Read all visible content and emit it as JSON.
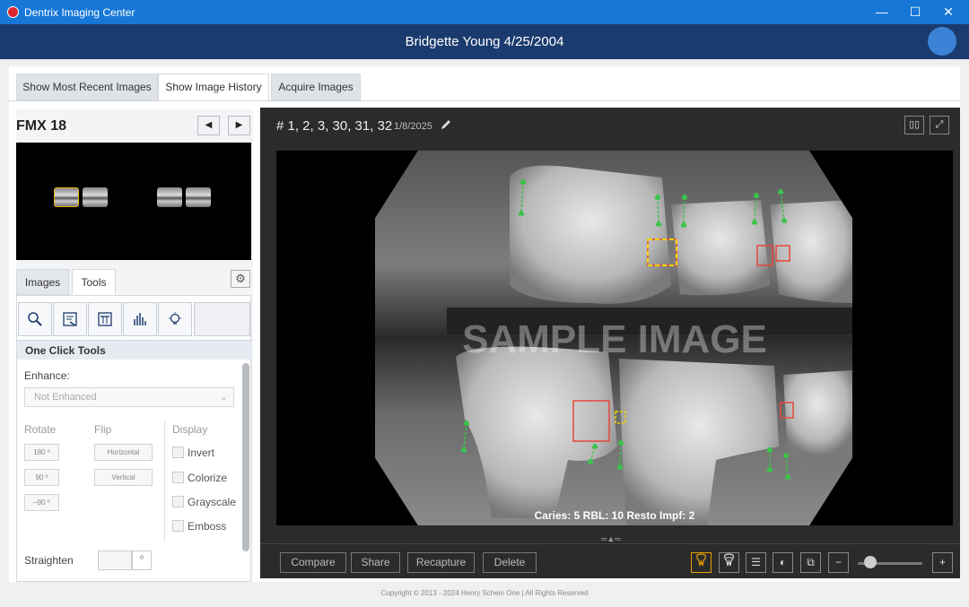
{
  "window": {
    "title": "Dentrix Imaging Center",
    "minimize": "—",
    "maximize": "☐",
    "close": "✕"
  },
  "header": {
    "patient": "Bridgette Young 4/25/2004"
  },
  "tabs": [
    "Show Most Recent Images",
    "Show Image History",
    "Acquire Images"
  ],
  "left": {
    "series_title": "FMX 18",
    "prev": "◀",
    "next": "▶",
    "subtabs": [
      "Images",
      "Tools"
    ],
    "gear": "⚙",
    "one_click": "One Click Tools",
    "enhance_label": "Enhance:",
    "enhance_value": "Not Enhanced",
    "rotate_label": "Rotate",
    "rotate_buttons": [
      "180 º",
      "90 º",
      "–90 º"
    ],
    "flip_label": "Flip",
    "flip_buttons": [
      "Horizontal",
      "Vertical"
    ],
    "display_label": "Display",
    "display_options": [
      "Invert",
      "Colorize",
      "Grayscale",
      "Emboss"
    ],
    "straighten_label": "Straighten",
    "straighten_unit": "º"
  },
  "viewer": {
    "teeth": "# 1, 2, 3, 30, 31, 32",
    "date": "1/8/2025",
    "watermark": "SAMPLE IMAGE",
    "findings": "Caries: 5 RBL: 10 Resto Impf: 2"
  },
  "actions": [
    "Compare",
    "Share",
    "Recapture",
    "Delete"
  ],
  "zoom": {
    "minus": "−",
    "plus": "+",
    "level": 0.15
  },
  "footer": "Copyright © 2013 - 2024 Henry Schein One | All Rights Reserved",
  "colors": {
    "titlebar": "#1677d7",
    "header": "#1b3b6e",
    "caries": "#e8473b",
    "pending": "#f1d100",
    "rbl": "#3bc24a"
  }
}
